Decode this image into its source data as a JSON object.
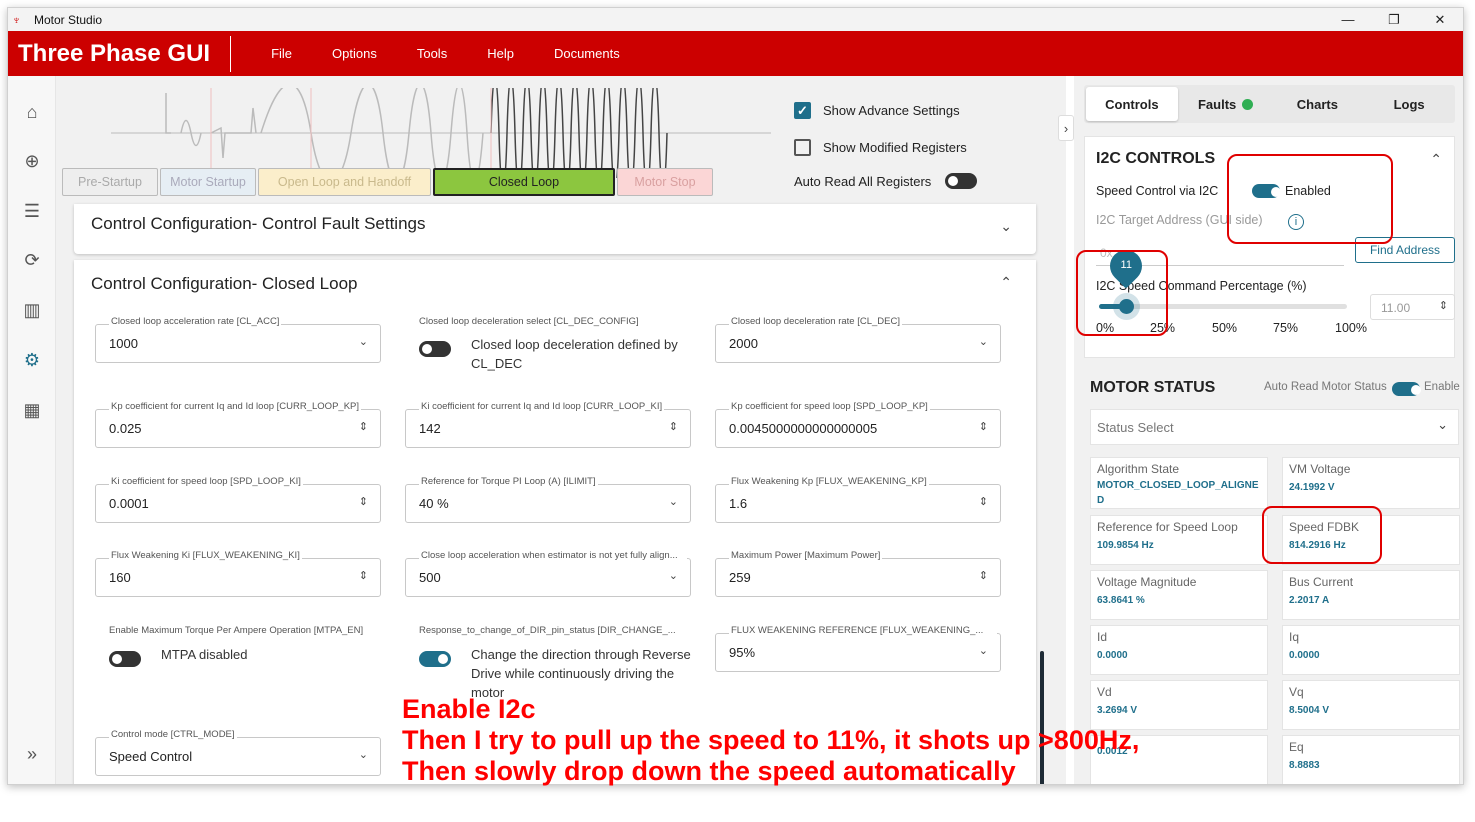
{
  "window": {
    "app_title": "Motor Studio",
    "minimize": "—",
    "maximize": "❐",
    "close": "✕"
  },
  "header": {
    "brand": "Three Phase GUI",
    "menu": [
      "File",
      "Options",
      "Tools",
      "Help",
      "Documents"
    ]
  },
  "phases": [
    "Pre-Startup",
    "Motor Startup",
    "Open Loop and Handoff",
    "Closed Loop",
    "Motor Stop"
  ],
  "settings": {
    "show_advance": "Show Advance Settings",
    "show_modified": "Show Modified Registers",
    "auto_read": "Auto Read All Registers"
  },
  "sections": {
    "fault_title": "Control Configuration- Control Fault Settings",
    "closed_loop_title": "Control Configuration- Closed Loop"
  },
  "fields": {
    "cl_acc": {
      "label": "Closed loop acceleration rate [CL_ACC]",
      "value": "1000"
    },
    "cl_dec_config": {
      "label": "Closed loop deceleration select [CL_DEC_CONFIG]",
      "text": "Closed loop deceleration defined by CL_DEC"
    },
    "cl_dec": {
      "label": "Closed loop deceleration rate [CL_DEC]",
      "value": "2000"
    },
    "curr_kp": {
      "label": "Kp coefficient for current Iq and Id loop [CURR_LOOP_KP]",
      "value": "0.025"
    },
    "curr_ki": {
      "label": "Ki coefficient for current Iq and Id loop [CURR_LOOP_KI]",
      "value": "142"
    },
    "spd_kp": {
      "label": "Kp coefficient for speed loop [SPD_LOOP_KP]",
      "value": "0.0045000000000000005"
    },
    "spd_ki": {
      "label": "Ki coefficient for speed loop [SPD_LOOP_KI]",
      "value": "0.0001"
    },
    "ilimit": {
      "label": "Reference for Torque PI Loop (A) [ILIMIT]",
      "value": "40 %"
    },
    "fw_kp": {
      "label": "Flux Weakening Kp [FLUX_WEAKENING_KP]",
      "value": "1.6"
    },
    "fw_ki": {
      "label": "Flux Weakening Ki [FLUX_WEAKENING_KI]",
      "value": "160"
    },
    "close_acc": {
      "label": "Close loop acceleration when estimator is not yet fully align...",
      "value": "500"
    },
    "max_power": {
      "label": "Maximum Power [Maximum Power]",
      "value": "259"
    },
    "mtpa": {
      "label": "Enable Maximum Torque Per Ampere Operation [MTPA_EN]",
      "text": "MTPA disabled"
    },
    "dir_change": {
      "label": "Response_to_change_of_DIR_pin_status [DIR_CHANGE_...",
      "text": "Change the direction through Reverse Drive while continuously driving the motor"
    },
    "fw_ref": {
      "label": "FLUX WEAKENING REFERENCE [FLUX_WEAKENING_...",
      "value": "95%"
    },
    "ctrl_mode": {
      "label": "Control mode [CTRL_MODE]",
      "value": "Speed Control"
    }
  },
  "tabs": [
    "Controls",
    "Faults",
    "Charts",
    "Logs"
  ],
  "i2c": {
    "title": "I2C CONTROLS",
    "speed_control_label": "Speed Control via I2C",
    "enabled": "Enabled",
    "target_label": "I2C Target Address (GUI side)",
    "target_value": "0x",
    "find_address": "Find Address",
    "speed_cmd_label": "I2C Speed Command Percentage (%)",
    "slider_value": 11,
    "slider_bubble": "11",
    "slider_marks": [
      "0%",
      "25%",
      "50%",
      "75%",
      "100%"
    ],
    "input_value": "11.00"
  },
  "motor_status": {
    "title": "MOTOR STATUS",
    "auto_read": "Auto Read Motor Status",
    "enable": "Enable",
    "status_select": "Status Select",
    "cells": [
      {
        "label": "Algorithm State",
        "value": "MOTOR_CLOSED_LOOP_ALIGNED"
      },
      {
        "label": "VM Voltage",
        "value": "24.1992 V"
      },
      {
        "label": "Reference for Speed Loop",
        "value": "109.9854 Hz"
      },
      {
        "label": "Speed FDBK",
        "value": "814.2916 Hz"
      },
      {
        "label": "Voltage Magnitude",
        "value": "63.8641 %"
      },
      {
        "label": "Bus Current",
        "value": "2.2017 A"
      },
      {
        "label": "Id",
        "value": "0.0000"
      },
      {
        "label": "Iq",
        "value": "0.0000"
      },
      {
        "label": "Vd",
        "value": "3.2694 V"
      },
      {
        "label": "Vq",
        "value": "8.5004 V"
      },
      {
        "label": "",
        "value": "0.0012"
      },
      {
        "label": "Eq",
        "value": "8.8883"
      }
    ]
  },
  "annotation": [
    "Enable I2c",
    "Then I try to pull up the speed to 11%, it shots up >800Hz,",
    "Then slowly drop down the speed automatically"
  ]
}
